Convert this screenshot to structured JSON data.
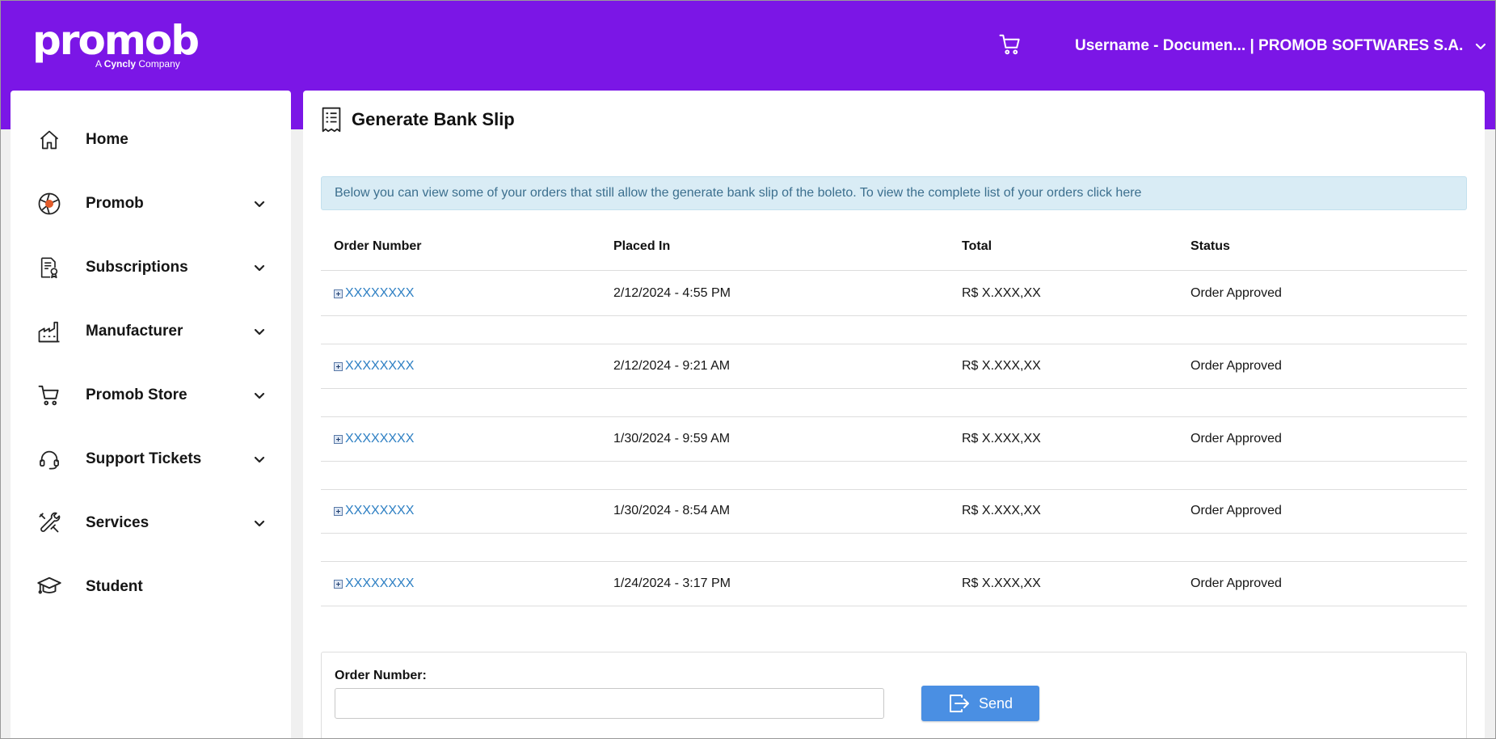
{
  "brand": {
    "logo_text": "promob",
    "tagline_prefix": "A",
    "tagline_brand": "Cyncly",
    "tagline_suffix": "Company",
    "accent_color": "#7b16e6"
  },
  "header": {
    "cart_icon": "cart-icon",
    "user_label": "Username - Documen... | PROMOB SOFTWARES S.A."
  },
  "sidebar": {
    "items": [
      {
        "label": "Home",
        "icon": "home-icon",
        "has_submenu": false
      },
      {
        "label": "Promob",
        "icon": "promob-logo-icon",
        "has_submenu": true
      },
      {
        "label": "Subscriptions",
        "icon": "document-badge-icon",
        "has_submenu": true
      },
      {
        "label": "Manufacturer",
        "icon": "factory-icon",
        "has_submenu": true
      },
      {
        "label": "Promob Store",
        "icon": "cart-icon",
        "has_submenu": true
      },
      {
        "label": "Support Tickets",
        "icon": "headset-icon",
        "has_submenu": true
      },
      {
        "label": "Services",
        "icon": "tools-icon",
        "has_submenu": true
      },
      {
        "label": "Student",
        "icon": "graduation-cap-icon",
        "has_submenu": false
      }
    ]
  },
  "main": {
    "title": "Generate Bank Slip",
    "title_icon": "receipt-icon",
    "info": {
      "text": "Below you can view some of your orders that still allow the generate bank slip of the boleto. To view the complete list of your orders ",
      "link_text": "click here"
    },
    "table": {
      "columns": [
        "Order Number",
        "Placed In",
        "Total",
        "Status"
      ],
      "rows": [
        {
          "order": "XXXXXXXX",
          "placed": "2/12/2024 - 4:55 PM",
          "total": "R$ X.XXX,XX",
          "status": "Order Approved"
        },
        {
          "order": "XXXXXXXX",
          "placed": "2/12/2024 - 9:21 AM",
          "total": "R$ X.XXX,XX",
          "status": "Order Approved"
        },
        {
          "order": "XXXXXXXX",
          "placed": "1/30/2024 - 9:59 AM",
          "total": "R$ X.XXX,XX",
          "status": "Order Approved"
        },
        {
          "order": "XXXXXXXX",
          "placed": "1/30/2024 - 8:54 AM",
          "total": "R$ X.XXX,XX",
          "status": "Order Approved"
        },
        {
          "order": "XXXXXXXX",
          "placed": "1/24/2024 - 3:17 PM",
          "total": "R$ X.XXX,XX",
          "status": "Order Approved"
        }
      ]
    },
    "form": {
      "label": "Order Number:",
      "input_value": "",
      "input_placeholder": "",
      "button_label": "Send",
      "button_color": "#4a8fe3"
    }
  }
}
